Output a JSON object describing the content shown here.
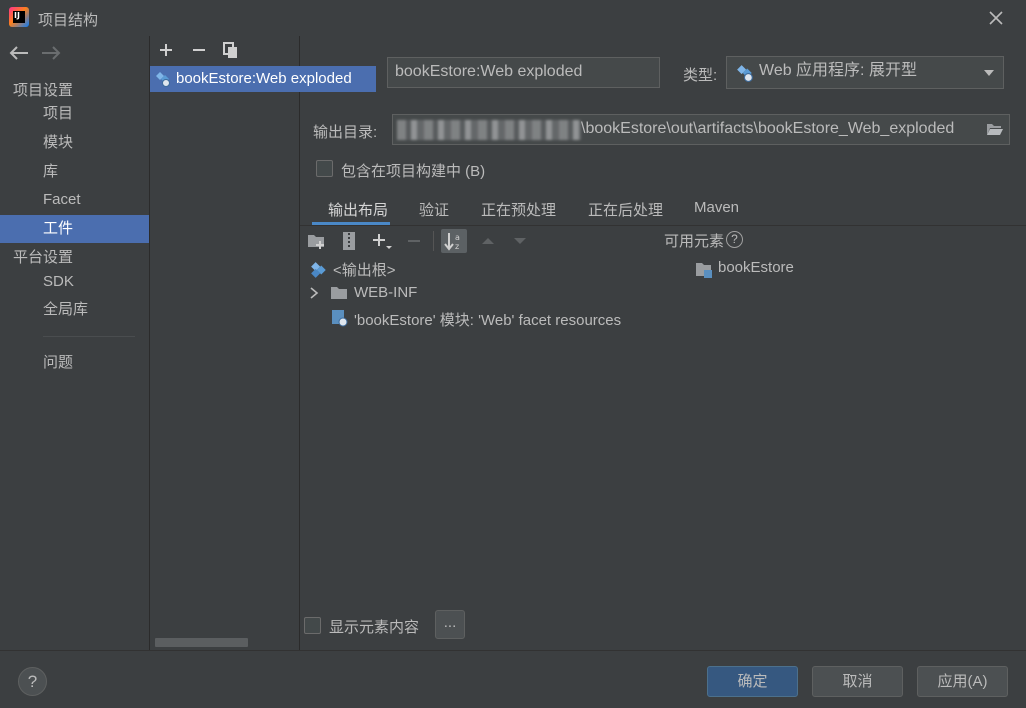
{
  "window": {
    "title": "项目结构",
    "app_icon_text": "IJ"
  },
  "left_nav": {
    "sections": [
      {
        "title": "项目设置",
        "items": [
          "项目",
          "模块",
          "库",
          "Facet",
          "工件"
        ]
      },
      {
        "title": "平台设置",
        "items": [
          "SDK",
          "全局库"
        ]
      }
    ],
    "problems": "问题",
    "selected": "工件"
  },
  "artifact_list": {
    "toolbar": {
      "add": "add-icon",
      "remove": "remove-icon",
      "copy": "copy-icon"
    },
    "items": [
      "bookEstore:Web exploded"
    ]
  },
  "artifact": {
    "name": "bookEstore:Web exploded",
    "type_label": "类型:",
    "type_value": "Web 应用程序: 展开型",
    "output_dir_label": "输出目录:",
    "output_dir_value": "\\bookEstore\\out\\artifacts\\bookEstore_Web_exploded",
    "include_in_build_label": "包含在项目构建中 (B)",
    "include_in_build_checked": false
  },
  "tabs": [
    "输出布局",
    "验证",
    "正在预处理",
    "正在后处理",
    "Maven"
  ],
  "active_tab": "输出布局",
  "layout_tree": {
    "root": "<输出根>",
    "children": [
      "WEB-INF",
      "'bookEstore' 模块: 'Web' facet resources"
    ]
  },
  "available": {
    "title": "可用元素",
    "help": "?",
    "items": [
      "bookEstore"
    ]
  },
  "show_content_label": "显示元素内容",
  "ellipsis_label": "...",
  "footer": {
    "help": "?",
    "ok": "确定",
    "cancel": "取消",
    "apply": "应用(A)"
  },
  "colors": {
    "background": "#3c3f41",
    "selection": "#4b6eaf",
    "default_button": "#365880",
    "tab_underline": "#4a88c7"
  }
}
